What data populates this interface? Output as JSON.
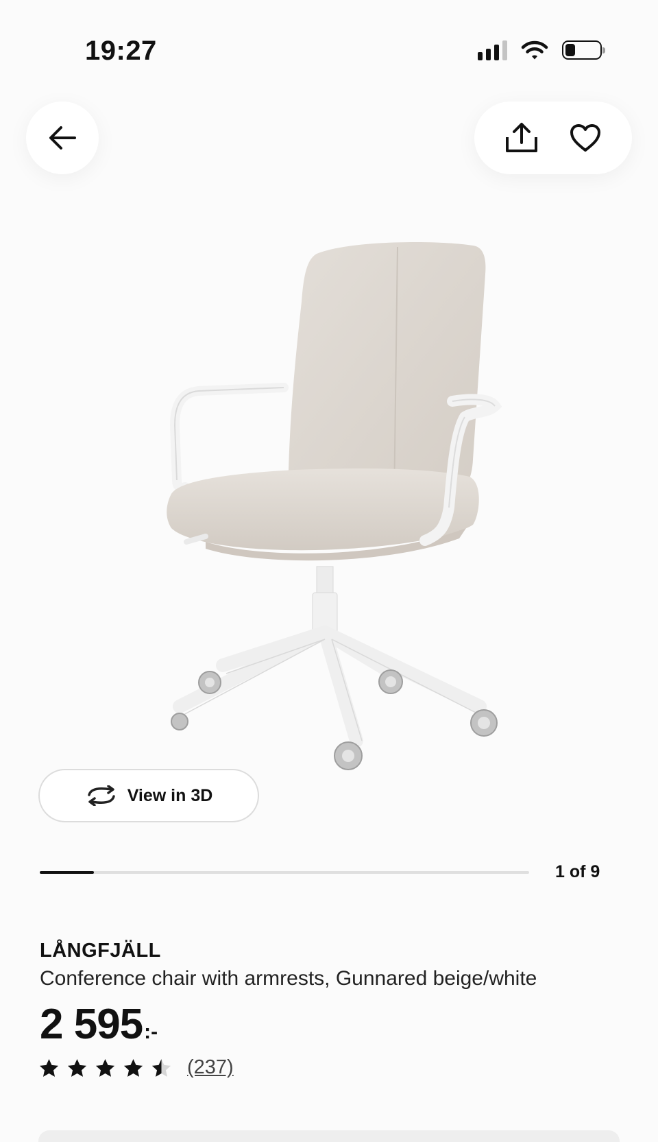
{
  "status_bar": {
    "time": "19:27",
    "signal_icon": "cellular-signal-icon",
    "wifi_icon": "wifi-icon",
    "battery_icon": "battery-icon",
    "battery_level": 0.3
  },
  "header": {
    "back_icon": "arrow-left-icon",
    "share_icon": "share-icon",
    "favorite_icon": "heart-icon"
  },
  "gallery": {
    "image_subject": "office-chair",
    "view3d_label": "View in 3D",
    "view3d_icon": "rotate-arrows-icon",
    "current_index": 1,
    "total": 9,
    "counter_text": "1 of 9",
    "progress_fraction": 0.111
  },
  "product": {
    "name": "LÅNGFJÄLL",
    "description": "Conference chair with armrests, Gunnared beige/white",
    "price": "2 595",
    "price_suffix": ":-",
    "rating": 4.5,
    "rating_max": 5,
    "review_count": "(237)"
  },
  "colors": {
    "text": "#111111",
    "background": "#fbfbfb",
    "chair_fabric": "#dcd6cf",
    "chair_frame": "#f4f4f4",
    "wheel": "#bdbdbd"
  }
}
